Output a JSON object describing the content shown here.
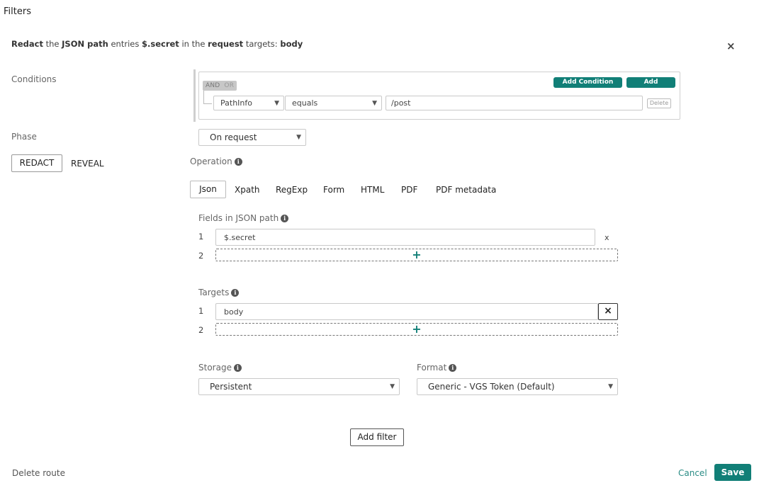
{
  "page_title": "Filters",
  "summary": {
    "action": "Redact",
    "t1": " the ",
    "path_type": "JSON path",
    "t2": " entries ",
    "field": "$.secret",
    "t3": " in the ",
    "phase": "request",
    "t4": " targets: ",
    "target": "body"
  },
  "close_label": "×",
  "conditions": {
    "label": "Conditions",
    "and_label": "AND",
    "or_label": "OR",
    "add_group_label": "Add Condition Group",
    "add_condition_label": "Add Condition",
    "rule": {
      "field": "PathInfo",
      "operator": "equals",
      "value": "/post",
      "delete_label": "Delete"
    }
  },
  "phase": {
    "label": "Phase",
    "value": "On request"
  },
  "mode": {
    "redact_label": "REDACT",
    "reveal_label": "REVEAL",
    "active": "REDACT"
  },
  "operation": {
    "label": "Operation",
    "tabs": [
      {
        "label": "Json",
        "active": true
      },
      {
        "label": "Xpath"
      },
      {
        "label": "RegExp"
      },
      {
        "label": "Form"
      },
      {
        "label": "HTML"
      },
      {
        "label": "PDF"
      },
      {
        "label": "PDF metadata"
      }
    ]
  },
  "fields": {
    "label": "Fields in JSON path",
    "rows": [
      {
        "num": "1",
        "value": "$.secret",
        "remove": "x"
      }
    ],
    "add_row_num": "2"
  },
  "targets": {
    "label": "Targets",
    "rows": [
      {
        "num": "1",
        "value": "body",
        "remove": "×"
      }
    ],
    "add_row_num": "2"
  },
  "storage": {
    "label": "Storage",
    "value": "Persistent"
  },
  "format": {
    "label": "Format",
    "value": "Generic - VGS Token (Default)"
  },
  "add_filter_label": "Add filter",
  "footer": {
    "delete_route": "Delete route",
    "cancel": "Cancel",
    "save": "Save"
  },
  "colors": {
    "accent": "#117f77"
  },
  "icons": {
    "info": "info-icon",
    "caret": "caret-down-icon",
    "plus": "plus-icon",
    "close": "close-icon"
  }
}
